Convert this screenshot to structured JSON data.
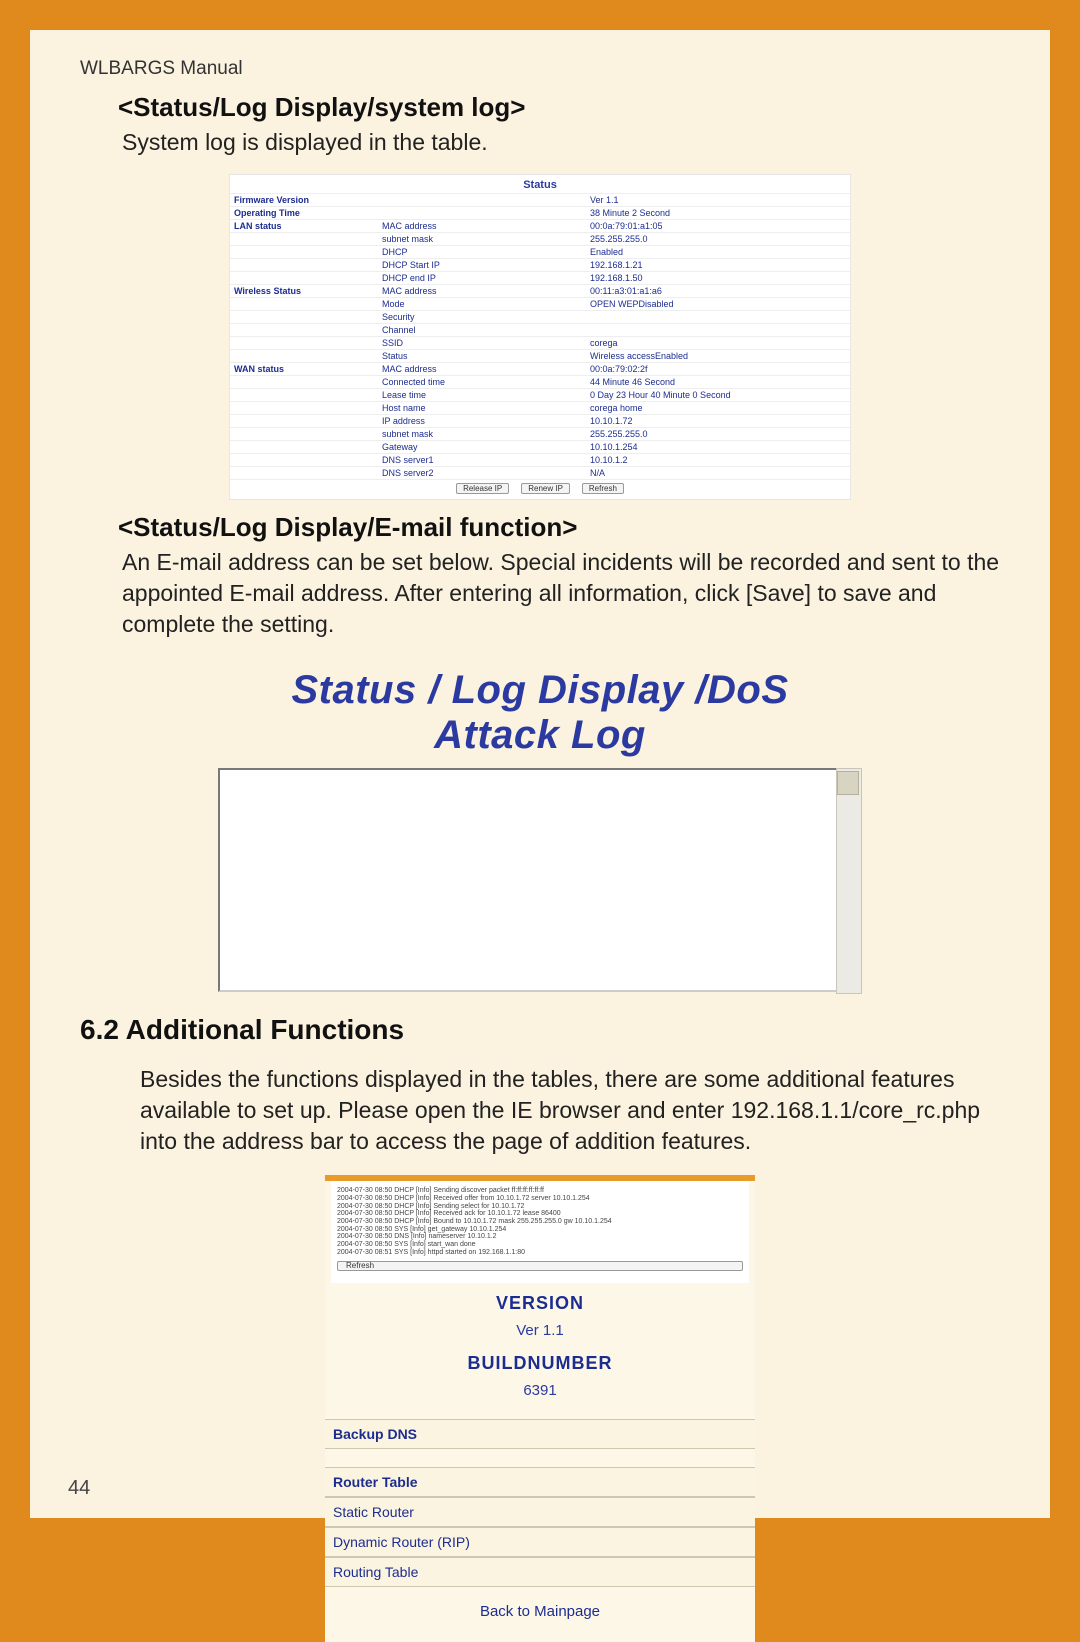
{
  "header": {
    "manual": "WLBARGS Manual"
  },
  "sec1": {
    "title": "<Status/Log Display/system log>",
    "body": "System log is displayed in the table."
  },
  "status": {
    "title": "Status",
    "rows": [
      {
        "c1": "Firmware Version",
        "c2": "",
        "c3": "Ver 1.1"
      },
      {
        "c1": "Operating Time",
        "c2": "",
        "c3": "38 Minute 2 Second"
      },
      {
        "c1": "LAN status",
        "c2": "MAC address",
        "c3": "00:0a:79:01:a1:05"
      },
      {
        "c1": "",
        "c2": "subnet mask",
        "c3": "255.255.255.0"
      },
      {
        "c1": "",
        "c2": "DHCP",
        "c3": "Enabled"
      },
      {
        "c1": "",
        "c2": "DHCP Start IP",
        "c3": "192.168.1.21"
      },
      {
        "c1": "",
        "c2": "DHCP end IP",
        "c3": "192.168.1.50"
      },
      {
        "c1": "Wireless Status",
        "c2": "MAC address",
        "c3": "00:11:a3:01:a1:a6"
      },
      {
        "c1": "",
        "c2": "Mode",
        "c3": "OPEN WEPDisabled"
      },
      {
        "c1": "",
        "c2": "Security",
        "c3": ""
      },
      {
        "c1": "",
        "c2": "Channel",
        "c3": ""
      },
      {
        "c1": "",
        "c2": "SSID",
        "c3": "corega"
      },
      {
        "c1": "",
        "c2": "Status",
        "c3": "Wireless accessEnabled"
      },
      {
        "c1": "WAN status",
        "c2": "MAC address",
        "c3": "00:0a:79:02:2f"
      },
      {
        "c1": "",
        "c2": "Connected time",
        "c3": "44 Minute 46 Second"
      },
      {
        "c1": "",
        "c2": "Lease time",
        "c3": "0 Day 23 Hour 40 Minute 0 Second"
      },
      {
        "c1": "",
        "c2": "Host name",
        "c3": "corega home"
      },
      {
        "c1": "",
        "c2": "IP address",
        "c3": "10.10.1.72"
      },
      {
        "c1": "",
        "c2": "subnet mask",
        "c3": "255.255.255.0"
      },
      {
        "c1": "",
        "c2": "Gateway",
        "c3": "10.10.1.254"
      },
      {
        "c1": "",
        "c2": "DNS server1",
        "c3": "10.10.1.2"
      },
      {
        "c1": "",
        "c2": "DNS server2",
        "c3": "N/A"
      }
    ],
    "buttons": {
      "b1": "Release IP",
      "b2": "Renew IP",
      "b3": "Refresh"
    }
  },
  "sec2": {
    "title": "<Status/Log Display/E-mail function>",
    "body": "An E-mail address can be set below.  Special incidents will be recorded and sent to the appointed E-mail address.  After entering all information, click [Save] to save and complete the setting."
  },
  "dos": {
    "title": "Status / Log Display /DoS Attack Log"
  },
  "h2": "6.2 Additional Functions",
  "sec3": {
    "body": "Besides the functions displayed in the tables, there are some additional features available to set up.  Please open the IE browser and enter 192.168.1.1/core_rc.php into the address bar to access the page of addition features."
  },
  "lower": {
    "version_h": "VERSION",
    "version_v": "Ver 1.1",
    "build_h": "BUILDNUMBER",
    "build_v": "6391",
    "link1": "Backup DNS",
    "link2_h": "Router Table",
    "link3": "Static Router",
    "link4": "Dynamic Router (RIP)",
    "link5": "Routing Table",
    "back": "Back to Mainpage",
    "refresh": "Refresh"
  },
  "page_number": "44"
}
